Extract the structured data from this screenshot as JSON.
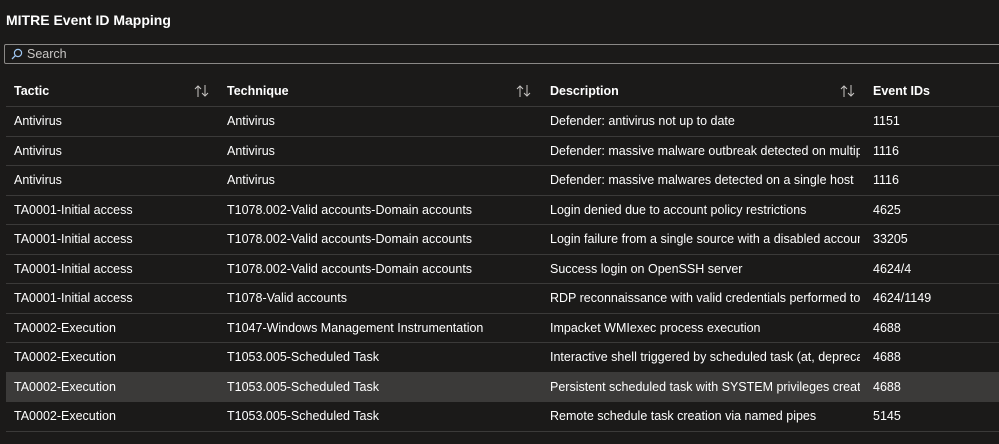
{
  "page": {
    "title": "MITRE Event ID Mapping"
  },
  "search": {
    "placeholder": "Search"
  },
  "table": {
    "columns": [
      "Tactic",
      "Technique",
      "Description",
      "Event IDs"
    ],
    "rows": [
      [
        "Antivirus",
        "Antivirus",
        "Defender: antivirus not up to date",
        "1151"
      ],
      [
        "Antivirus",
        "Antivirus",
        "Defender: massive malware outbreak detected on multipl...",
        "1116"
      ],
      [
        "Antivirus",
        "Antivirus",
        "Defender: massive malwares detected on a single host",
        "1116"
      ],
      [
        "TA0001-Initial access",
        "T1078.002-Valid accounts-Domain accounts",
        "Login denied due to account policy restrictions",
        "4625"
      ],
      [
        "TA0001-Initial access",
        "T1078.002-Valid accounts-Domain accounts",
        "Login failure from a single source with a disabled account",
        "33205"
      ],
      [
        "TA0001-Initial access",
        "T1078.002-Valid accounts-Domain accounts",
        "Success login on OpenSSH server",
        "4624/4"
      ],
      [
        "TA0001-Initial access",
        "T1078-Valid accounts",
        "RDP reconnaissance with valid credentials performed to ...",
        "4624/1149"
      ],
      [
        "TA0002-Execution",
        "T1047-Windows Management Instrumentation",
        "Impacket WMIexec process execution",
        "4688"
      ],
      [
        "TA0002-Execution",
        "T1053.005-Scheduled Task",
        "Interactive shell triggered by scheduled task (at, deprecat...",
        "4688"
      ],
      [
        "TA0002-Execution",
        "T1053.005-Scheduled Task",
        "Persistent scheduled task with SYSTEM privileges creation",
        "4688"
      ],
      [
        "TA0002-Execution",
        "T1053.005-Scheduled Task",
        "Remote schedule task creation via named pipes",
        "5145"
      ]
    ],
    "selected_row": 9
  },
  "icons": {
    "search": "search-icon",
    "sort": "sort-icon"
  },
  "colors": {
    "background": "#1b1a19",
    "selected_row": "#3b3a39",
    "divider": "#3b3a39",
    "text": "#ffffff"
  }
}
